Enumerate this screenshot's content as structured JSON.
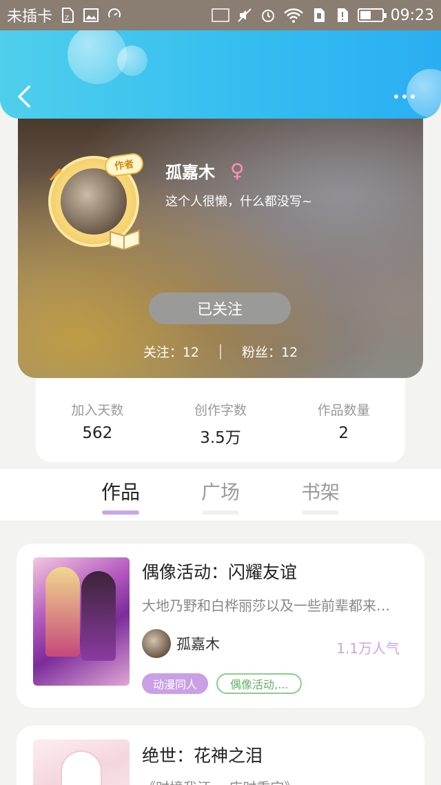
{
  "status_bar": {
    "carrier": "未插卡",
    "time": "09:23",
    "nfc": "NFC",
    "icons": [
      "sim-icon",
      "image-icon",
      "loading-icon",
      "nfc-icon",
      "mute-icon",
      "alarm-icon",
      "wifi-icon",
      "sim2-icon",
      "notice-icon",
      "battery-icon"
    ],
    "battery_level": 0.45
  },
  "header": {
    "back_icon": "chevron-left-icon",
    "more_icon": "more-dots-icon",
    "color": "#37bff0"
  },
  "profile": {
    "badge": "作者",
    "name": "孤嘉木",
    "gender_symbol": "♀",
    "bio": "这个人很懒，什么都没写~",
    "follow_button": "已关注",
    "following_label": "关注：12",
    "followers_label": "粉丝：12"
  },
  "info": {
    "items": [
      {
        "label": "加入天数",
        "value": "562"
      },
      {
        "label": "创作字数",
        "value": "3.5万"
      },
      {
        "label": "作品数量",
        "value": "2"
      }
    ]
  },
  "tabs": [
    {
      "label": "作品",
      "active": true
    },
    {
      "label": "广场",
      "active": false
    },
    {
      "label": "书架",
      "active": false
    }
  ],
  "works": [
    {
      "title": "偶像活动：闪耀友谊",
      "desc": "大地乃野和白桦丽莎以及一些前辈都来…",
      "author": "孤嘉木",
      "popularity": "1.1万人气",
      "tags": [
        "动漫同人",
        "偶像活动,..."
      ]
    },
    {
      "title": "绝世：花神之泪",
      "desc": "《时境我汪 一店时重宝》"
    }
  ],
  "colors": {
    "accent_purple": "#c7a8e6",
    "tag_green": "#8ccb8c"
  }
}
